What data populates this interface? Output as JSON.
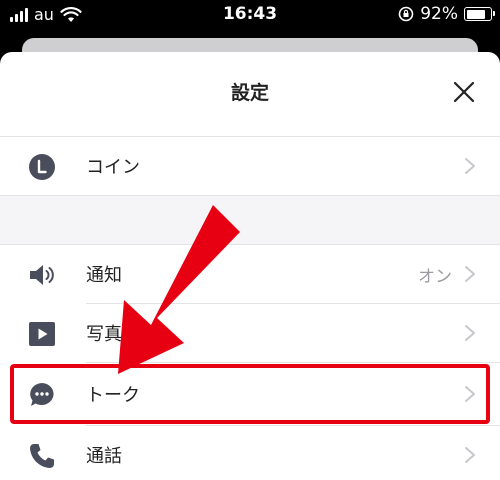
{
  "status_bar": {
    "carrier": "au",
    "time": "16:43",
    "battery_percent": "92%",
    "battery_level": 0.92
  },
  "sheet": {
    "title": "設定"
  },
  "rows": {
    "coin": {
      "label": "コイン",
      "icon": "coin-icon"
    },
    "notifications": {
      "label": "通知",
      "value": "オン",
      "icon": "speaker-icon"
    },
    "photos": {
      "label": "写真",
      "icon": "play-icon"
    },
    "talk": {
      "label": "トーク",
      "icon": "chat-bubble-icon"
    },
    "calls": {
      "label": "通話",
      "icon": "phone-icon"
    }
  },
  "colors": {
    "highlight": "#e60012",
    "icon": "#4a4d5c",
    "chevron": "#c7c7cc"
  }
}
